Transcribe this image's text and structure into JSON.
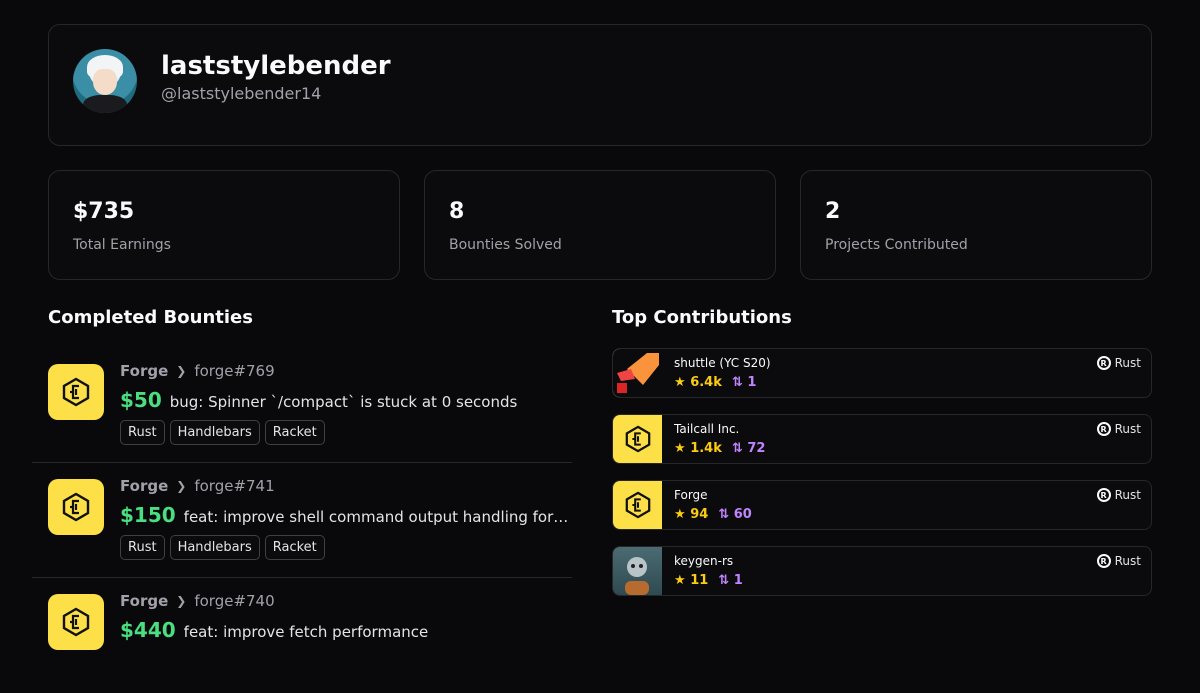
{
  "profile": {
    "name": "laststylebender",
    "handle": "@laststylebender14"
  },
  "stats": [
    {
      "value": "$735",
      "label": "Total Earnings"
    },
    {
      "value": "8",
      "label": "Bounties Solved"
    },
    {
      "value": "2",
      "label": "Projects Contributed"
    }
  ],
  "completed": {
    "title": "Completed Bounties",
    "items": [
      {
        "org": "Forge",
        "issue": "forge#769",
        "amount": "$50",
        "title": "bug: Spinner `/compact` is stuck at 0 seconds",
        "tags": [
          "Rust",
          "Handlebars",
          "Racket"
        ]
      },
      {
        "org": "Forge",
        "issue": "forge#741",
        "amount": "$150",
        "title": "feat: improve shell command output handling for…",
        "tags": [
          "Rust",
          "Handlebars",
          "Racket"
        ]
      },
      {
        "org": "Forge",
        "issue": "forge#740",
        "amount": "$440",
        "title": "feat: improve fetch performance",
        "tags": []
      }
    ]
  },
  "contributions": {
    "title": "Top Contributions",
    "items": [
      {
        "name": "shuttle (YC S20)",
        "stars": "6.4k",
        "prs": "1",
        "lang": "Rust",
        "logo": "shuttle-logo"
      },
      {
        "name": "Tailcall Inc.",
        "stars": "1.4k",
        "prs": "72",
        "lang": "Rust",
        "logo": "forge-logo"
      },
      {
        "name": "Forge",
        "stars": "94",
        "prs": "60",
        "lang": "Rust",
        "logo": "forge-logo"
      },
      {
        "name": "keygen-rs",
        "stars": "11",
        "prs": "1",
        "lang": "Rust",
        "logo": "keygen-avatar"
      }
    ]
  },
  "colors": {
    "accent_green": "#4ade80",
    "star_yellow": "#facc15",
    "pr_purple": "#c084fc",
    "logo_yellow": "#fde047"
  }
}
